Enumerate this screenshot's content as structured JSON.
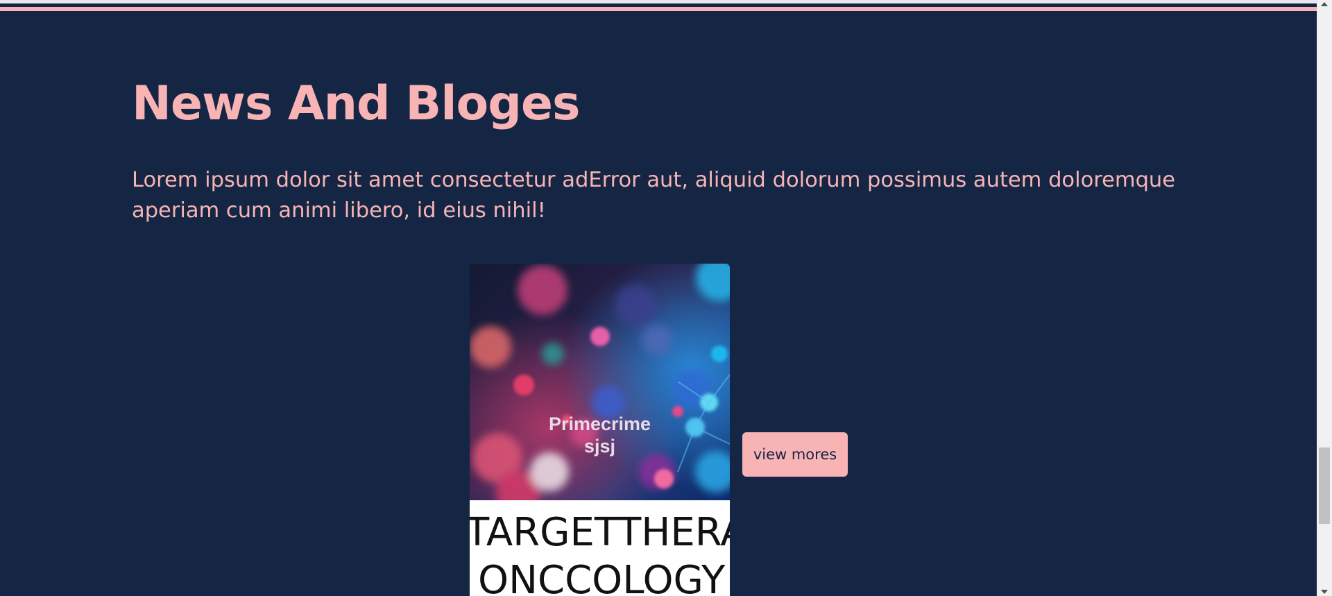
{
  "section": {
    "title": "News And Bloges",
    "description": "Lorem ipsum dolor sit amet consectetur adError aut, aliquid dolorum possimus autem doloremque aperiam cum animi libero, id eius nihil!"
  },
  "card": {
    "image_caption_line1": "Primecrime",
    "image_caption_line2": "sjsj",
    "banner_line1": "TARGETTHERAPY",
    "banner_line2": "ONCCOLOGY"
  },
  "actions": {
    "view_more_label": "view mores"
  },
  "colors": {
    "background": "#142643",
    "accent_pink": "#f8b4b5",
    "button_text": "#142643"
  },
  "icons": {
    "scroll_up": "chevron-up-icon",
    "scroll_down": "chevron-down-icon"
  }
}
